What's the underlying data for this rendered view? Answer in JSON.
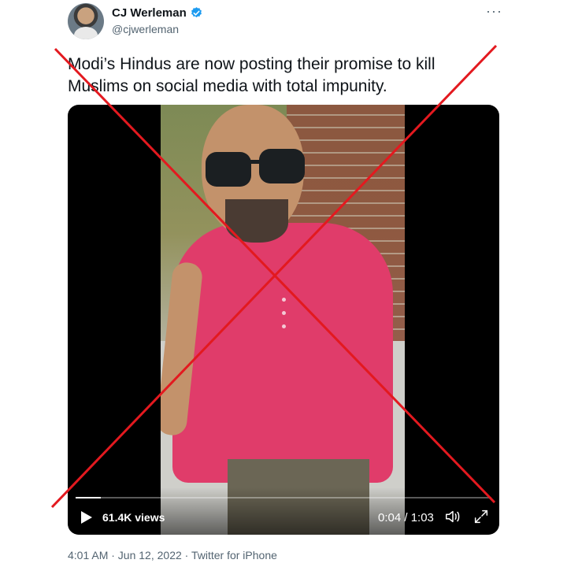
{
  "author": {
    "name": "CJ Werleman",
    "handle": "@cjwerleman",
    "verified": true,
    "badge_color": "#1d9bf0"
  },
  "more_icon": "more-horizontal-icon",
  "tweet": {
    "text": "Modi’s Hindus are now posting their promise to kill Muslims on social media with total impunity."
  },
  "video": {
    "views": "61.4K views",
    "time": "0:04 / 1:03",
    "progress": 0.06
  },
  "meta": {
    "timestamp": "4:01 AM · Jun 12, 2022 · Twitter for iPhone"
  },
  "colors": {
    "text": "#0f1419",
    "secondary": "#536471",
    "cross": "#e3191f"
  }
}
